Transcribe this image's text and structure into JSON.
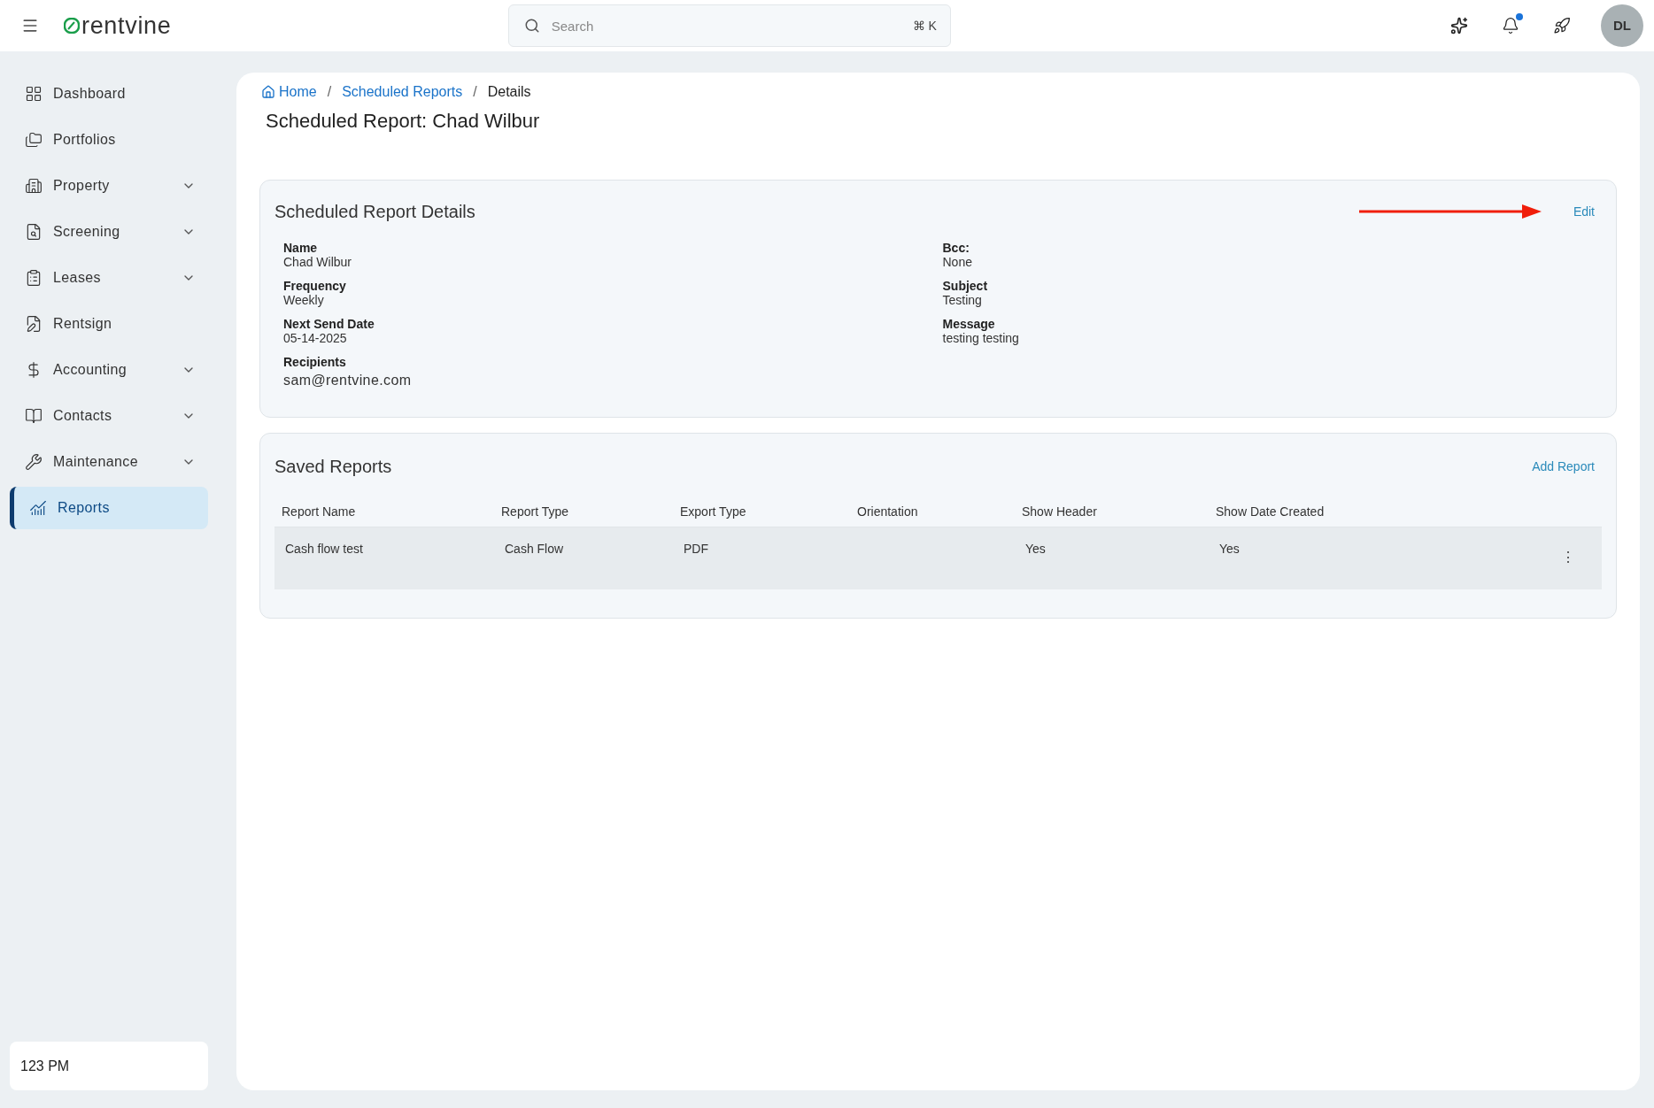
{
  "topbar": {
    "logo": "rentvine",
    "search": {
      "placeholder": "Search",
      "shortcut": "⌘ K"
    },
    "notification_dot": true,
    "avatar": "DL"
  },
  "sidebar": {
    "items": [
      {
        "label": "Dashboard",
        "expandable": false,
        "selected": false
      },
      {
        "label": "Portfolios",
        "expandable": false,
        "selected": false
      },
      {
        "label": "Property",
        "expandable": true,
        "selected": false
      },
      {
        "label": "Screening",
        "expandable": true,
        "selected": false
      },
      {
        "label": "Leases",
        "expandable": true,
        "selected": false
      },
      {
        "label": "Rentsign",
        "expandable": false,
        "selected": false
      },
      {
        "label": "Accounting",
        "expandable": true,
        "selected": false
      },
      {
        "label": "Contacts",
        "expandable": true,
        "selected": false
      },
      {
        "label": "Maintenance",
        "expandable": true,
        "selected": false
      },
      {
        "label": "Reports",
        "expandable": false,
        "selected": true
      }
    ],
    "footer": "123 PM"
  },
  "breadcrumbs": [
    {
      "kind": "link",
      "label": "Home"
    },
    {
      "kind": "separator",
      "label": "/"
    },
    {
      "kind": "link",
      "label": "Scheduled Reports"
    },
    {
      "kind": "separator",
      "label": "/"
    },
    {
      "kind": "current",
      "label": "Details"
    }
  ],
  "page_title": "Scheduled Report: Chad Wilbur",
  "details": {
    "title": "Scheduled Report Details",
    "action": "Edit",
    "left": [
      {
        "label": "Name",
        "value": "Chad Wilbur"
      },
      {
        "label": "Frequency",
        "value": "Weekly"
      },
      {
        "label": "Next Send Date",
        "value": "05-14-2025"
      },
      {
        "label": "Recipients",
        "value": "sam@rentvine.com"
      }
    ],
    "right": [
      {
        "label": "Bcc:",
        "value": "None"
      },
      {
        "label": "Subject",
        "value": "Testing"
      },
      {
        "label": "Message",
        "value": "testing testing"
      }
    ]
  },
  "saved_reports": {
    "title": "Saved Reports",
    "action": "Add Report",
    "columns": [
      "Report Name",
      "Report Type",
      "Export Type",
      "Orientation",
      "Show Header",
      "Show Date Created"
    ],
    "rows": [
      {
        "cells": [
          "Cash flow test",
          "Cash Flow",
          "PDF",
          "",
          "Yes",
          "Yes"
        ],
        "menu": "⋮"
      }
    ]
  }
}
